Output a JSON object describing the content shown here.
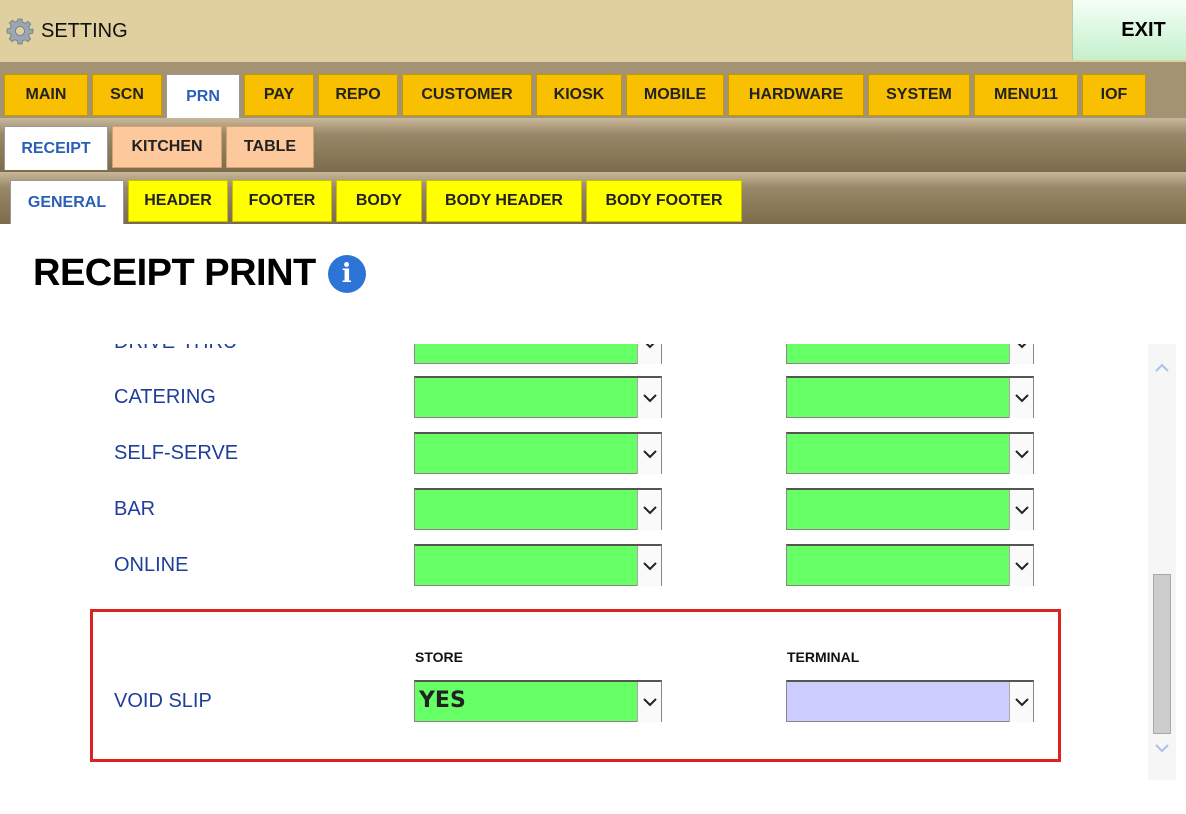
{
  "window": {
    "title": "SETTING",
    "exit_label": "EXIT"
  },
  "main_tabs": [
    "MAIN",
    "SCN",
    "PRN",
    "PAY",
    "REPO",
    "CUSTOMER",
    "KIOSK",
    "MOBILE",
    "HARDWARE",
    "SYSTEM",
    "MENU11",
    "IOF"
  ],
  "main_active": "PRN",
  "sub_tabs": [
    "RECEIPT",
    "KITCHEN",
    "TABLE"
  ],
  "sub_active": "RECEIPT",
  "section_tabs": [
    "GENERAL",
    "HEADER",
    "FOOTER",
    "BODY",
    "BODY HEADER",
    "BODY FOOTER"
  ],
  "section_active": "GENERAL",
  "page": {
    "title": "RECEIPT PRINT"
  },
  "rows": [
    {
      "label": "DRIVE-THRU",
      "store": "",
      "terminal": ""
    },
    {
      "label": "CATERING",
      "store": "",
      "terminal": ""
    },
    {
      "label": "SELF-SERVE",
      "store": "",
      "terminal": ""
    },
    {
      "label": "BAR",
      "store": "",
      "terminal": ""
    },
    {
      "label": "ONLINE",
      "store": "",
      "terminal": ""
    }
  ],
  "void_slip": {
    "label": "VOID SLIP",
    "store_header": "STORE",
    "terminal_header": "TERMINAL",
    "store_value": "YES",
    "terminal_value": ""
  },
  "colors": {
    "dropdown_green": "#66ff66",
    "dropdown_lavender": "#ccccff",
    "highlight_red": "#dd2222",
    "label_blue": "#1f3e9a"
  }
}
